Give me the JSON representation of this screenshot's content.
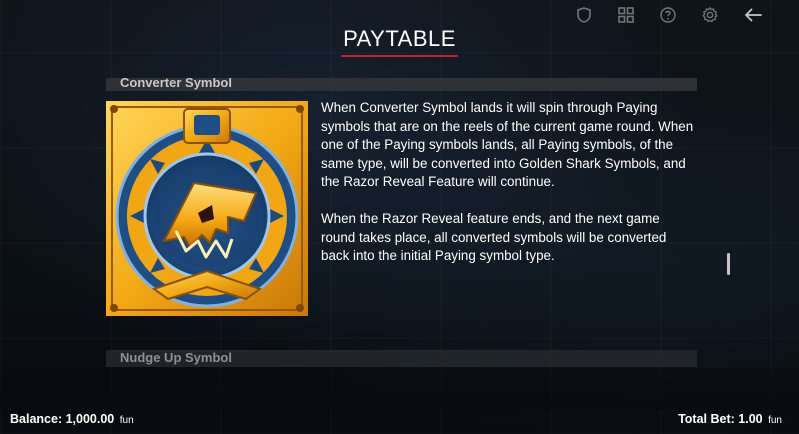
{
  "header": {
    "title": "PAYTABLE",
    "icons": [
      "shield-icon",
      "grid-icon",
      "help-icon",
      "settings-icon",
      "back-arrow-icon"
    ]
  },
  "sections": {
    "converter": {
      "title": "Converter Symbol",
      "paragraph_1": "When Converter Symbol lands it will spin through Paying symbols that are on the reels of the current game round. When one of the Paying symbols lands, all Paying symbols, of the same type, will be converted into Golden Shark Symbols, and the Razor Reveal Feature will continue.",
      "paragraph_2": "When the Razor Reveal feature ends, and the next game round takes place, all converted symbols will be converted back into the initial Paying symbol type."
    },
    "nudge": {
      "title": "Nudge Up Symbol"
    }
  },
  "footer": {
    "balance_label": "Balance:",
    "balance_value": "1,000.00",
    "balance_unit": "fun",
    "bet_label": "Total Bet:",
    "bet_value": "1.00",
    "bet_unit": "fun"
  },
  "colors": {
    "accent_red": "#c8202a",
    "gold": "#f3b21a",
    "blue_ring": "#2a6fb5"
  }
}
